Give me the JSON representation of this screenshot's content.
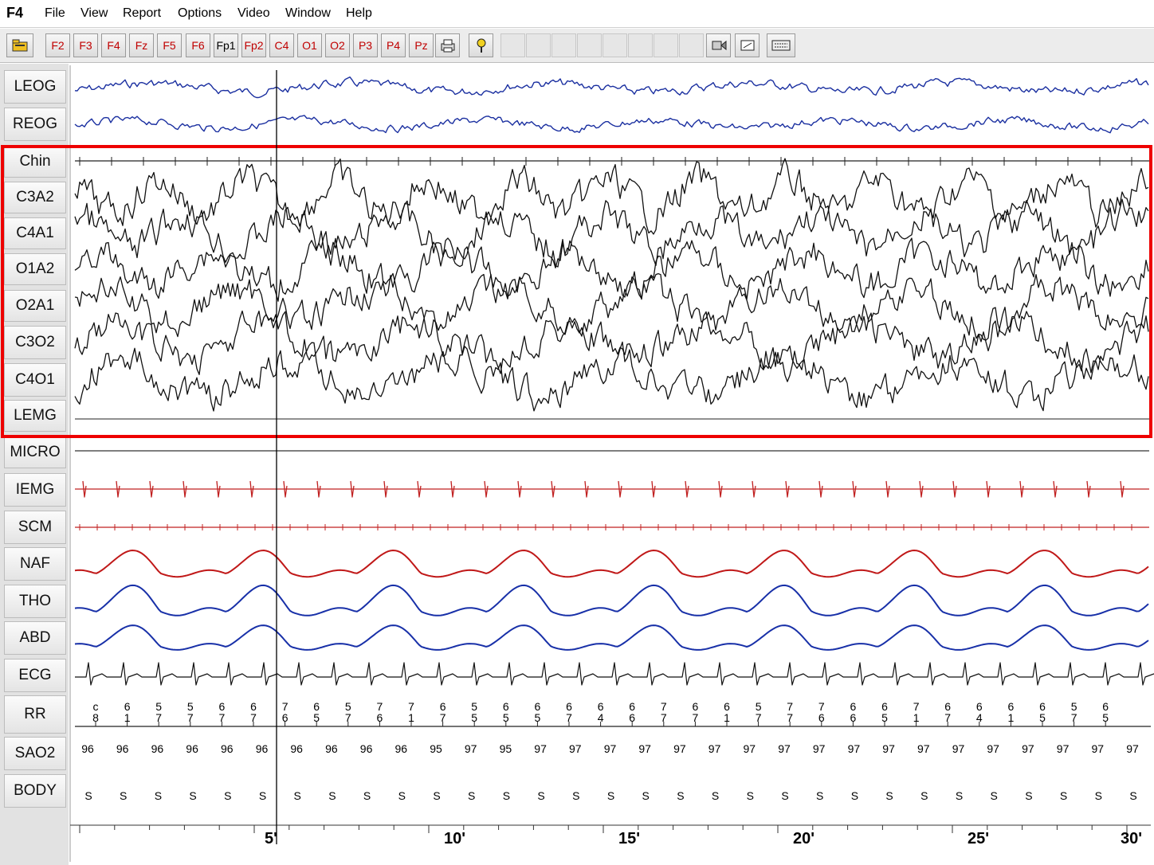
{
  "menu": {
    "app_label": "F4",
    "items": [
      "File",
      "View",
      "Report",
      "Options",
      "Video",
      "Window",
      "Help"
    ]
  },
  "toolbar": {
    "channel_buttons": [
      "F2",
      "F3",
      "F4",
      "Fz",
      "F5",
      "F6",
      "Fp1",
      "Fp2",
      "C4",
      "O1",
      "O2",
      "P3",
      "P4",
      "Pz"
    ],
    "icons": [
      "open-file-icon",
      "print-icon",
      "marker-icon",
      "video-icon",
      "screen-icon",
      "keyboard-icon"
    ]
  },
  "channels": [
    "LEOG",
    "REOG",
    "Chin",
    "C3A2",
    "C4A1",
    "O1A2",
    "O2A1",
    "C3O2",
    "C4O1",
    "LEMG",
    "MICRO",
    "IEMG",
    "SCM",
    "NAF",
    "THO",
    "ABD",
    "ECG",
    "RR",
    "SAO2",
    "BODY"
  ],
  "rr_values": [
    [
      "c",
      "8"
    ],
    [
      "6",
      "1"
    ],
    [
      "5",
      "7"
    ],
    [
      "5",
      "7"
    ],
    [
      "6",
      "7"
    ],
    [
      "6",
      "7"
    ],
    [
      "7",
      "6"
    ],
    [
      "6",
      "5"
    ],
    [
      "5",
      "7"
    ],
    [
      "7",
      "6"
    ],
    [
      "7",
      "1"
    ],
    [
      "6",
      "7"
    ],
    [
      "5",
      "5"
    ],
    [
      "6",
      "5"
    ],
    [
      "6",
      "5"
    ],
    [
      "6",
      "7"
    ],
    [
      "6",
      "4"
    ],
    [
      "6",
      "6"
    ],
    [
      "7",
      "7"
    ],
    [
      "6",
      "7"
    ],
    [
      "6",
      "1"
    ],
    [
      "5",
      "7"
    ],
    [
      "7",
      "7"
    ],
    [
      "7",
      "6"
    ],
    [
      "6",
      "6"
    ],
    [
      "6",
      "5"
    ],
    [
      "7",
      "1"
    ],
    [
      "6",
      "7"
    ],
    [
      "6",
      "4"
    ],
    [
      "6",
      "1"
    ],
    [
      "6",
      "5"
    ],
    [
      "5",
      "7"
    ],
    [
      "6",
      "5"
    ]
  ],
  "sao2_values": [
    "96",
    "96",
    "96",
    "96",
    "96",
    "96",
    "96",
    "96",
    "96",
    "96",
    "95",
    "97",
    "95",
    "97",
    "97",
    "97",
    "97",
    "97",
    "97",
    "97",
    "97",
    "97",
    "97",
    "97",
    "97",
    "97",
    "97",
    "97",
    "97",
    "97",
    "97"
  ],
  "body_values": [
    "S",
    "S",
    "S",
    "S",
    "S",
    "S",
    "S",
    "S",
    "S",
    "S",
    "S",
    "S",
    "S",
    "S",
    "S",
    "S",
    "S",
    "S",
    "S",
    "S",
    "S",
    "S",
    "S",
    "S",
    "S",
    "S",
    "S",
    "S",
    "S",
    "S",
    "S"
  ],
  "time_axis": [
    "5'",
    "10'",
    "15'",
    "20'",
    "25'",
    "30'"
  ],
  "colors": {
    "highlight": "#ee0000",
    "eog": "#1a2fa0",
    "eeg": "#111111",
    "emg_red": "#c02020",
    "resp_red": "#c01818",
    "resp_blue": "#1830a8"
  }
}
